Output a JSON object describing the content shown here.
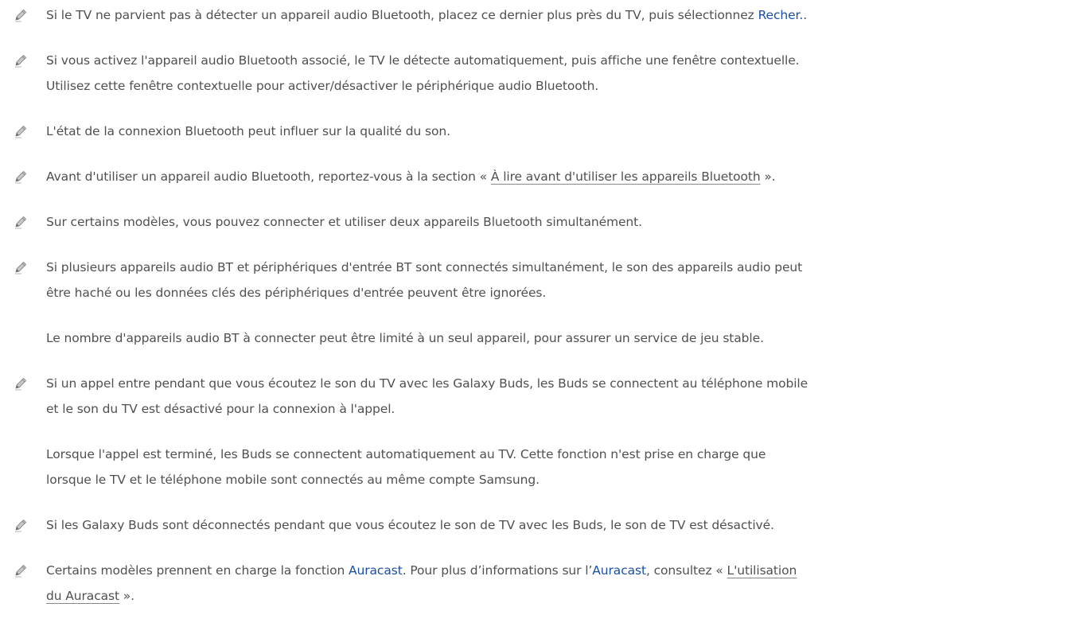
{
  "notes": [
    {
      "icon": "pencil-note-icon",
      "lines": [
        [
          "Si le TV ne parvient pas à détecter un appareil audio Bluetooth, placez ce dernier plus près du TV, puis sélectionnez ",
          {
            "kw": "Recher."
          },
          "."
        ]
      ]
    },
    {
      "icon": "pencil-note-icon",
      "lines": [
        [
          "Si vous activez l'appareil audio Bluetooth associé, le TV le détecte automatiquement, puis affiche une fenêtre contextuelle."
        ],
        [
          "Utilisez cette fenêtre contextuelle pour activer/désactiver le périphérique audio Bluetooth."
        ]
      ]
    },
    {
      "icon": "pencil-note-icon",
      "lines": [
        [
          "L'état de la connexion Bluetooth peut influer sur la qualité du son."
        ]
      ]
    },
    {
      "icon": "pencil-note-icon",
      "lines": [
        [
          "Avant d'utiliser un appareil audio Bluetooth, reportez-vous à la section « ",
          {
            "ref": "À lire avant d'utiliser les appareils Bluetooth"
          },
          " »."
        ]
      ]
    },
    {
      "icon": "pencil-note-icon",
      "lines": [
        [
          "Sur certains modèles, vous pouvez connecter et utiliser deux appareils Bluetooth simultanément."
        ]
      ]
    },
    {
      "icon": "pencil-note-icon",
      "lines": [
        [
          "Si plusieurs appareils audio BT et périphériques d'entrée BT sont connectés simultanément, le son des appareils audio peut"
        ],
        [
          "être haché ou les données clés des périphériques d'entrée peuvent être ignorées."
        ]
      ]
    },
    {
      "icon": null,
      "lines": [
        [
          "Le nombre d'appareils audio BT à connecter peut être limité à un seul appareil, pour assurer un service de jeu stable."
        ]
      ]
    },
    {
      "icon": "pencil-note-icon",
      "lines": [
        [
          "Si un appel entre pendant que vous écoutez le son du TV avec les Galaxy Buds, les Buds se connectent au téléphone mobile"
        ],
        [
          "et le son du TV est désactivé pour la connexion à l'appel."
        ]
      ]
    },
    {
      "icon": null,
      "lines": [
        [
          "Lorsque l'appel est terminé, les Buds se connectent automatiquement au TV. Cette fonction n'est prise en charge que"
        ],
        [
          "lorsque le TV et le téléphone mobile sont connectés au même compte Samsung."
        ]
      ]
    },
    {
      "icon": "pencil-note-icon",
      "lines": [
        [
          "Si les Galaxy Buds sont déconnectés pendant que vous écoutez le son de TV avec les Buds, le son de TV est désactivé."
        ]
      ]
    },
    {
      "icon": "pencil-note-icon",
      "lines": [
        [
          "Certains modèles prennent en charge la fonction ",
          {
            "kw": "Auracast"
          },
          ". Pour plus d’informations sur l’",
          {
            "kw": "Auracast"
          },
          ", consultez « ",
          {
            "ref": "L'utilisation"
          }
        ],
        [
          {
            "ref": "du Auracast"
          },
          " »."
        ]
      ]
    }
  ]
}
